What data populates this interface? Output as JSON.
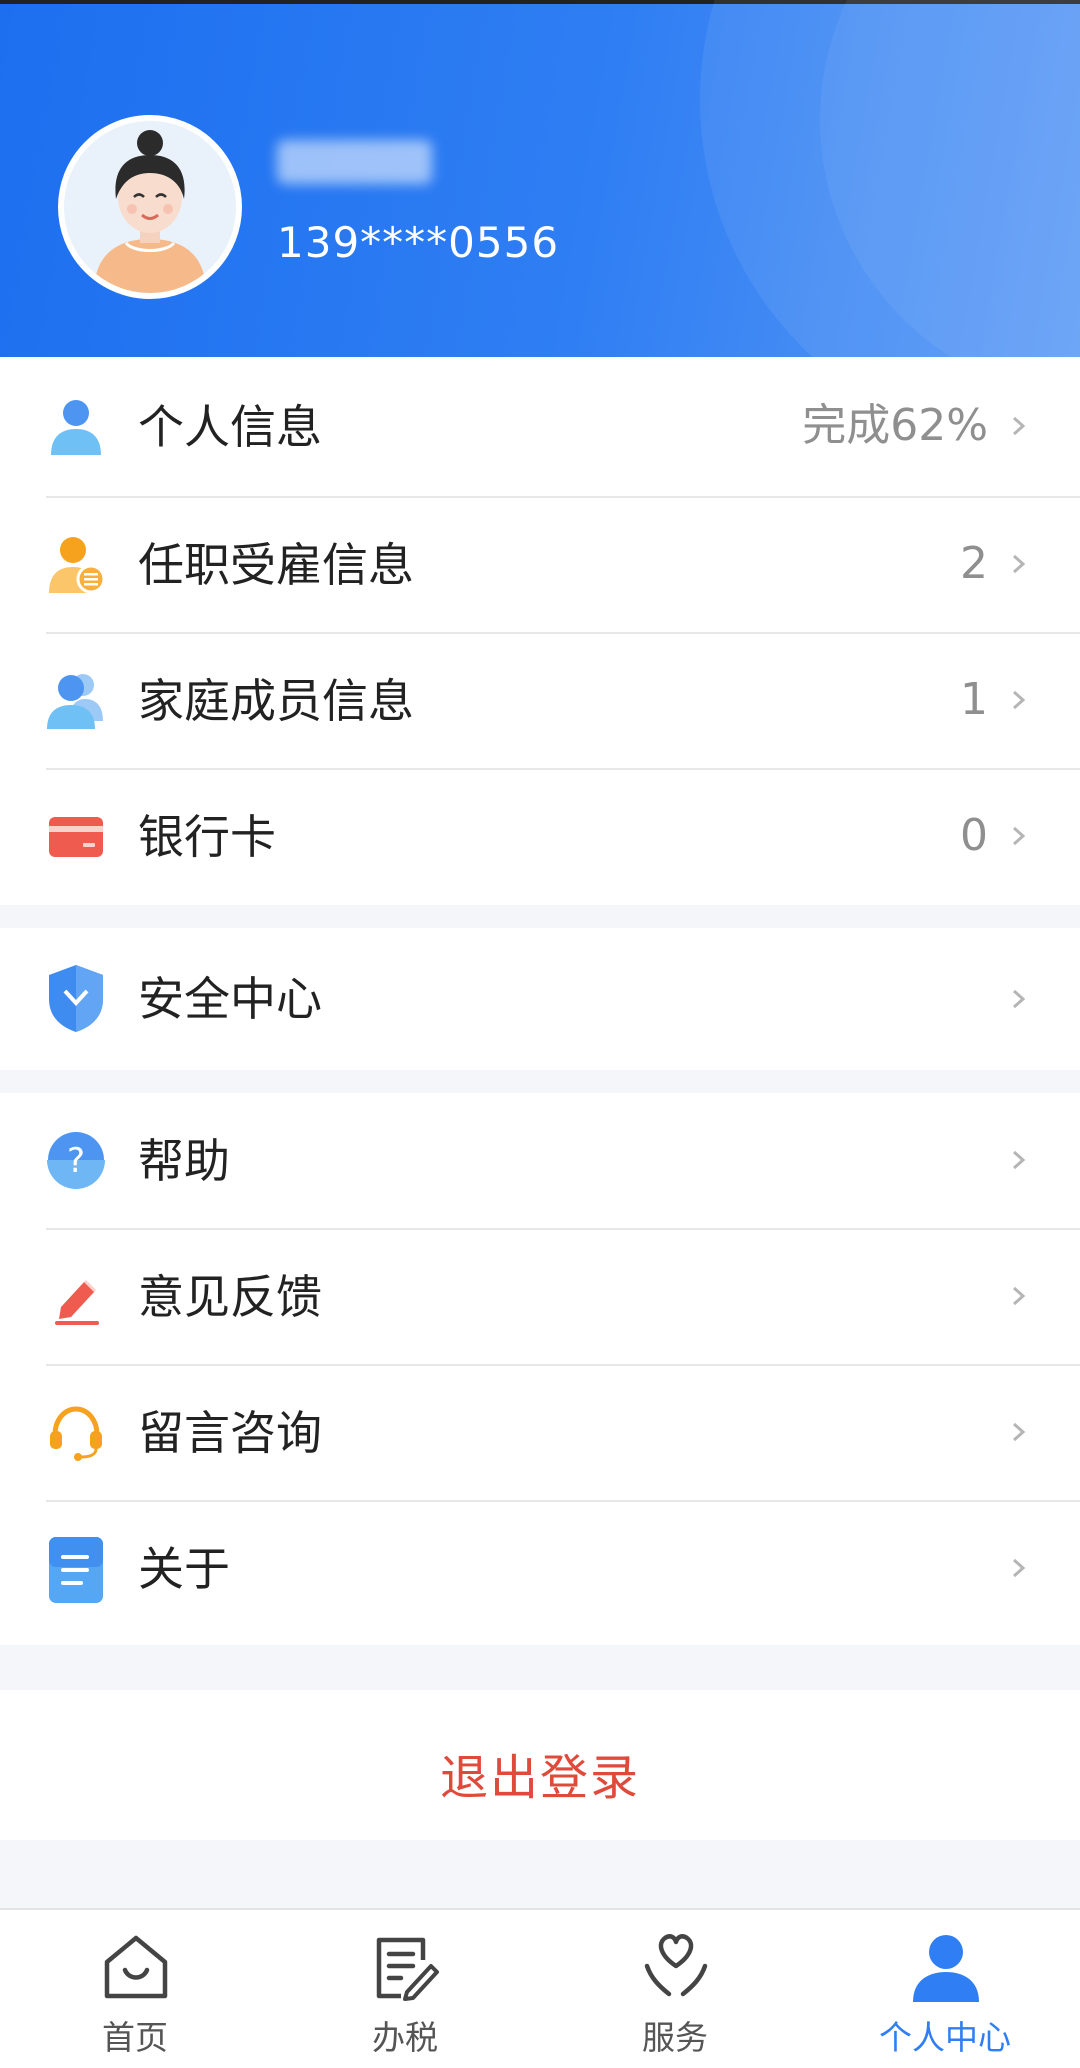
{
  "profile": {
    "name": "",
    "phone": "139****0556"
  },
  "menu": {
    "group1": [
      {
        "label": "个人信息",
        "value": "完成62%",
        "icon": "user-icon"
      },
      {
        "label": "任职受雇信息",
        "value": "2",
        "icon": "employment-icon"
      },
      {
        "label": "家庭成员信息",
        "value": "1",
        "icon": "family-icon"
      },
      {
        "label": "银行卡",
        "value": "0",
        "icon": "bank-card-icon"
      }
    ],
    "group2": [
      {
        "label": "安全中心",
        "value": "",
        "icon": "shield-icon"
      }
    ],
    "group3": [
      {
        "label": "帮助",
        "value": "",
        "icon": "help-icon"
      },
      {
        "label": "意见反馈",
        "value": "",
        "icon": "feedback-pen-icon"
      },
      {
        "label": "留言咨询",
        "value": "",
        "icon": "headset-icon"
      },
      {
        "label": "关于",
        "value": "",
        "icon": "document-icon"
      }
    ]
  },
  "logout_label": "退出登录",
  "tabs": [
    {
      "label": "首页",
      "icon": "home-icon",
      "active": false
    },
    {
      "label": "办税",
      "icon": "tax-form-icon",
      "active": false
    },
    {
      "label": "服务",
      "icon": "service-heart-icon",
      "active": false
    },
    {
      "label": "个人中心",
      "icon": "profile-icon",
      "active": true
    }
  ],
  "colors": {
    "accent": "#2f7ef3",
    "logout": "#e04a3b",
    "header_start": "#1d6ff0"
  }
}
